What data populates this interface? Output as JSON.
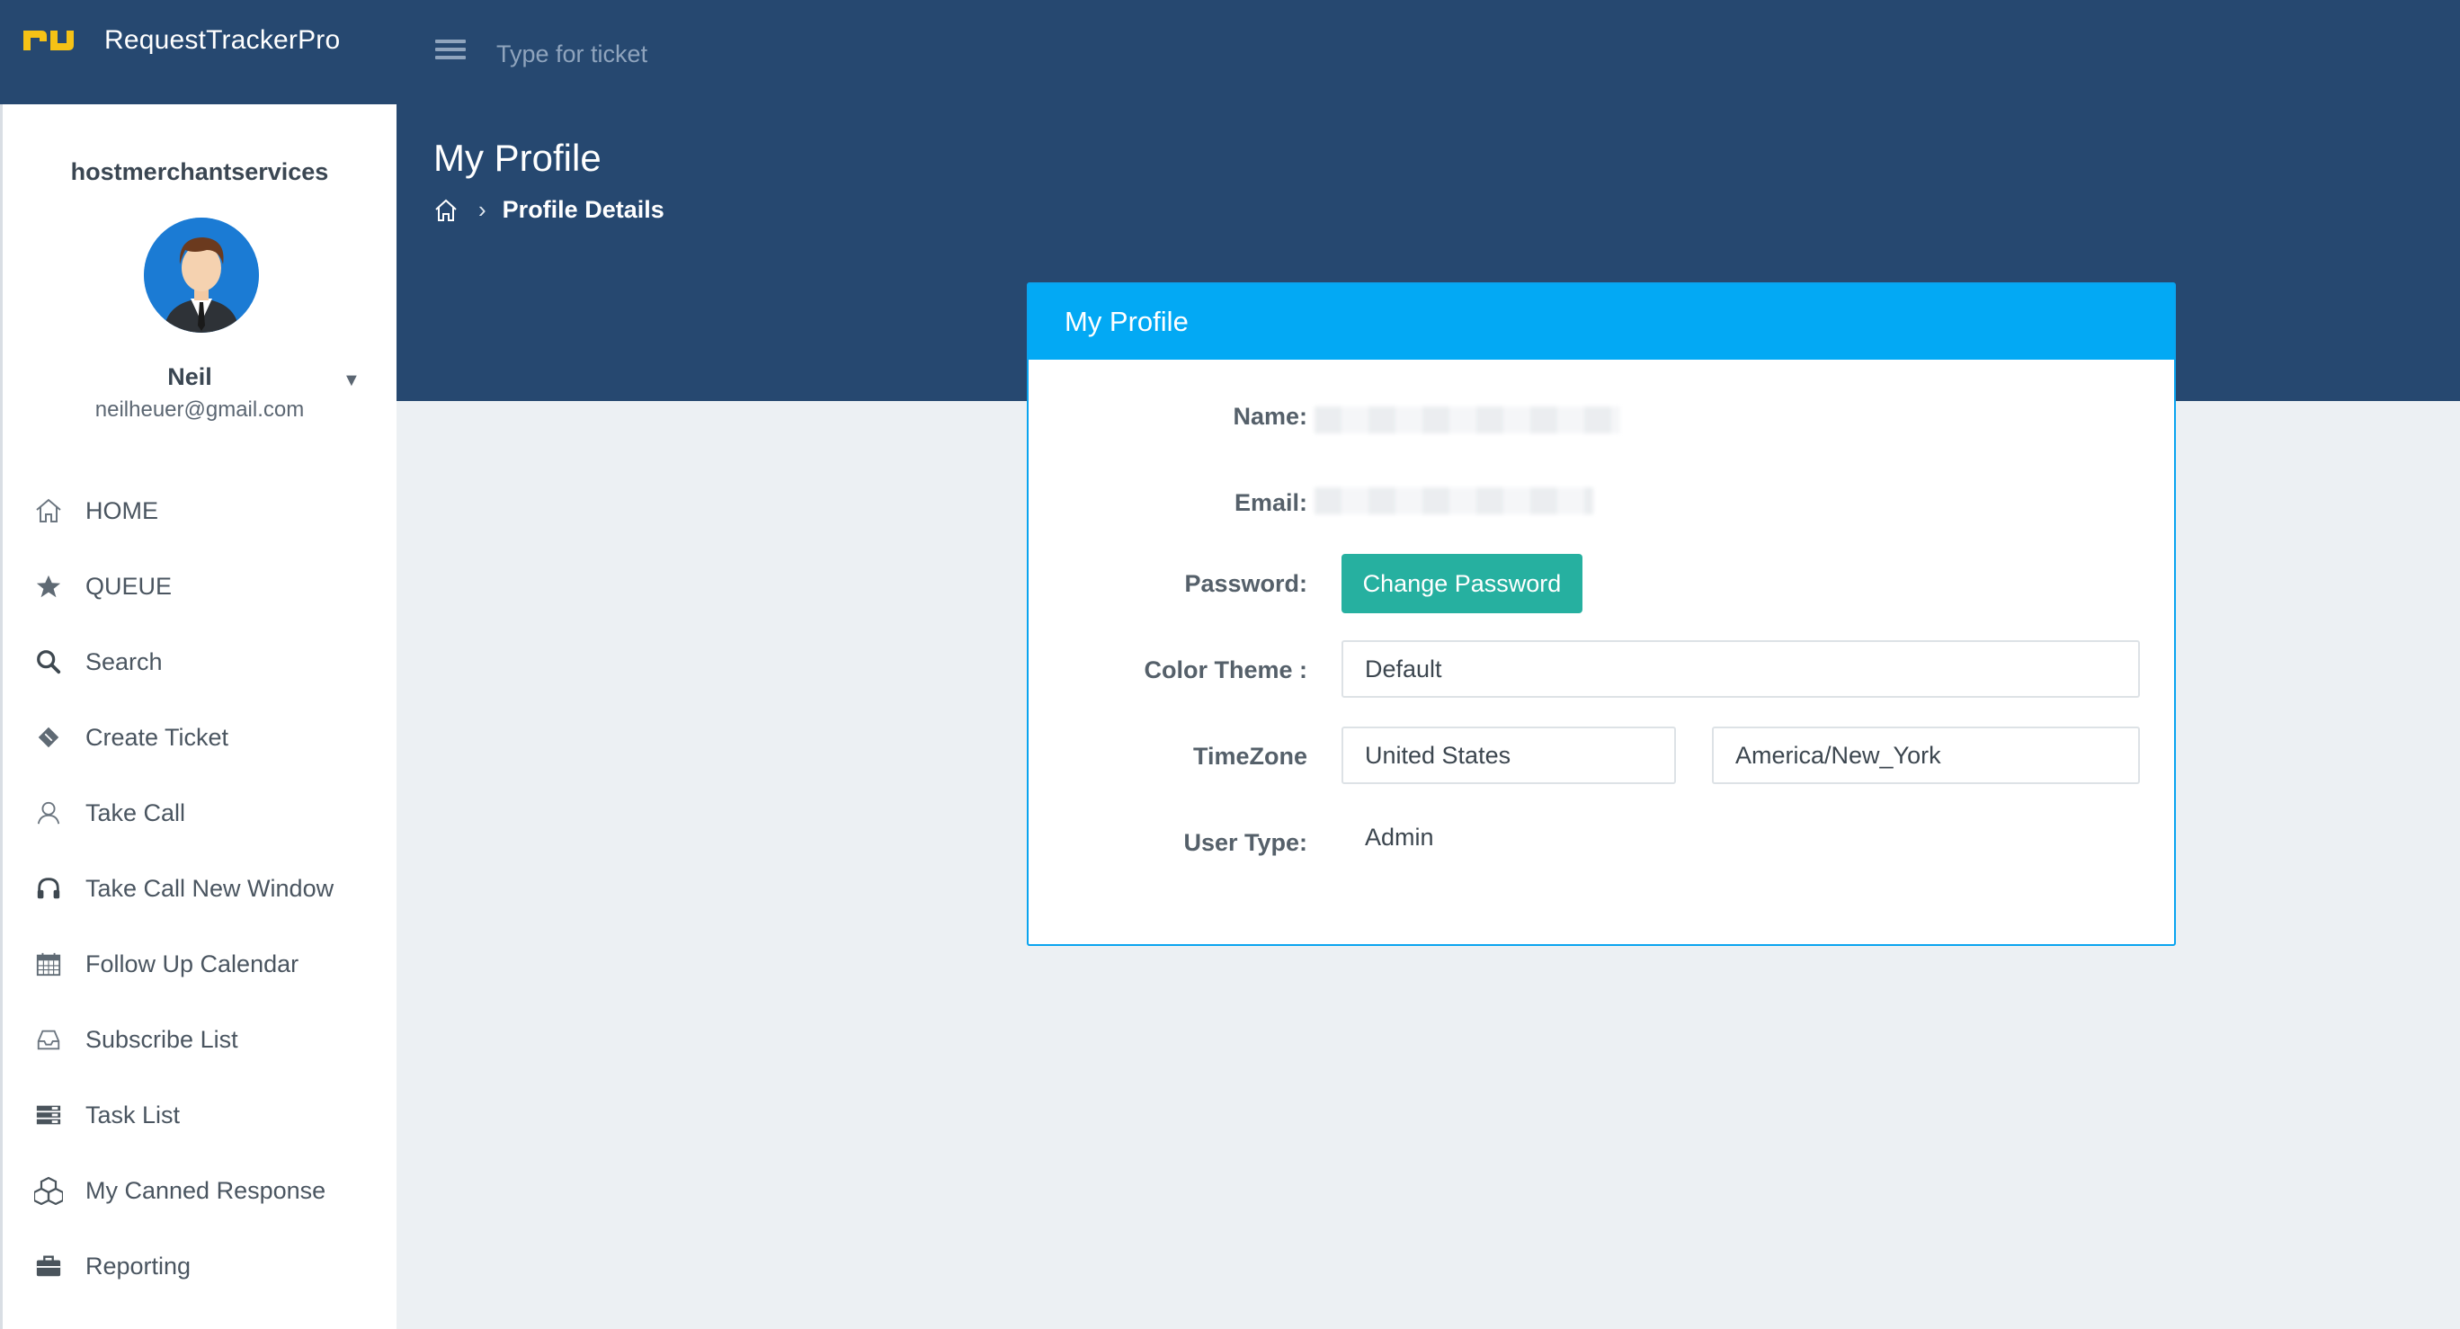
{
  "app": {
    "name": "RequestTrackerPro"
  },
  "header": {
    "search_placeholder": "Type for ticket"
  },
  "page": {
    "title": "My Profile",
    "breadcrumb": "Profile Details"
  },
  "sidebar": {
    "company": "hostmerchantservices",
    "user_name": "Neil",
    "user_email": "neilheuer@gmail.com",
    "items": [
      {
        "label": "HOME",
        "icon": "home-icon"
      },
      {
        "label": "QUEUE",
        "icon": "star-icon"
      },
      {
        "label": "Search",
        "icon": "search-icon"
      },
      {
        "label": "Create Ticket",
        "icon": "ticket-icon"
      },
      {
        "label": "Take Call",
        "icon": "user-icon"
      },
      {
        "label": "Take Call New Window",
        "icon": "headphones-icon"
      },
      {
        "label": "Follow Up Calendar",
        "icon": "calendar-icon"
      },
      {
        "label": "Subscribe List",
        "icon": "inbox-icon"
      },
      {
        "label": "Task List",
        "icon": "list-icon"
      },
      {
        "label": "My Canned Response",
        "icon": "cubes-icon"
      },
      {
        "label": "Reporting",
        "icon": "briefcase-icon"
      }
    ]
  },
  "profile": {
    "card_title": "My Profile",
    "labels": {
      "name": "Name:",
      "email": "Email:",
      "password": "Password:",
      "color_theme": "Color Theme :",
      "timezone": "TimeZone",
      "user_type": "User Type:"
    },
    "change_password_label": "Change Password",
    "color_theme_value": "Default",
    "timezone_country": "United States",
    "timezone_zone": "America/New_York",
    "user_type_value": "Admin"
  },
  "colors": {
    "header_bg": "#264870",
    "card_header": "#03a9f4",
    "button": "#26b0a0",
    "page_bg": "#ecf0f3"
  }
}
